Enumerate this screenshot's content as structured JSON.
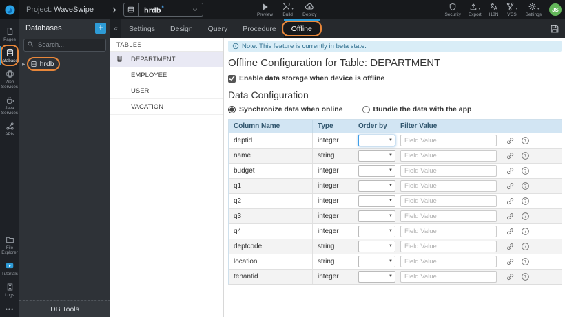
{
  "topbar": {
    "project_prefix": "Project:",
    "project_name": "WaveSwipe",
    "db_selector_value": "hrdb",
    "db_selector_modified_mark": "*",
    "actions": [
      {
        "name": "preview",
        "label": "Preview",
        "icon": "play-icon",
        "caret": false
      },
      {
        "name": "build",
        "label": "Build",
        "icon": "build-icon",
        "caret": true
      },
      {
        "name": "deploy",
        "label": "Deploy",
        "icon": "deploy-icon",
        "caret": false
      }
    ],
    "right_actions": [
      {
        "name": "security",
        "label": "Security",
        "icon": "shield-icon",
        "caret": false
      },
      {
        "name": "export",
        "label": "Export",
        "icon": "export-icon",
        "caret": true
      },
      {
        "name": "i18n",
        "label": "I18N",
        "icon": "translate-icon",
        "caret": false
      },
      {
        "name": "vcs",
        "label": "VCS",
        "icon": "branch-icon",
        "caret": true
      },
      {
        "name": "settings",
        "label": "Settings",
        "icon": "gear-icon",
        "caret": true
      }
    ],
    "avatar_initials": "JS"
  },
  "sidebar": {
    "top_items": [
      {
        "name": "pages",
        "label": "Pages",
        "icon": "page-icon",
        "active": false,
        "annotated": false
      },
      {
        "name": "databases",
        "label": "Databases",
        "icon": "database-icon",
        "active": true,
        "annotated": true
      },
      {
        "name": "web-services",
        "label": "Web Services",
        "icon": "globe-icon",
        "active": false,
        "annotated": false
      },
      {
        "name": "java-services",
        "label": "Java Services",
        "icon": "coffee-icon",
        "active": false,
        "annotated": false
      },
      {
        "name": "apis",
        "label": "APIs",
        "icon": "nodes-icon",
        "active": false,
        "annotated": false
      }
    ],
    "bottom_items": [
      {
        "name": "file-explorer",
        "label": "File Explorer",
        "icon": "folder-icon",
        "active": false,
        "annotated": false
      },
      {
        "name": "tutorials",
        "label": "Tutorials",
        "icon": "video-icon",
        "active": false,
        "annotated": false
      },
      {
        "name": "logs",
        "label": "Logs",
        "icon": "logs-icon",
        "active": false,
        "annotated": false
      }
    ],
    "more_label": "•••"
  },
  "db_panel": {
    "title": "Databases",
    "search_placeholder": "Search...",
    "items": [
      {
        "name": "hrdb",
        "label": "hrdb",
        "annotated": true
      }
    ],
    "footer_label": "DB Tools"
  },
  "tabbar": {
    "tabs": [
      {
        "label": "Settings",
        "active": false,
        "annotated": false
      },
      {
        "label": "Design",
        "active": false,
        "annotated": false
      },
      {
        "label": "Query",
        "active": false,
        "annotated": false
      },
      {
        "label": "Procedure",
        "active": false,
        "annotated": false
      },
      {
        "label": "Offline",
        "active": true,
        "annotated": true
      }
    ]
  },
  "tables_panel": {
    "title": "TABLES",
    "items": [
      {
        "label": "DEPARTMENT",
        "selected": true
      },
      {
        "label": "EMPLOYEE",
        "selected": false
      },
      {
        "label": "USER",
        "selected": false
      },
      {
        "label": "VACATION",
        "selected": false
      }
    ]
  },
  "main": {
    "note_text": "Note: This feature is currently in beta state.",
    "heading": "Offline Configuration for Table: DEPARTMENT",
    "enable_label": "Enable data storage when device is offline",
    "enable_checked": true,
    "section_title": "Data Configuration",
    "radios": [
      {
        "label": "Synchronize data when online",
        "selected": true
      },
      {
        "label": "Bundle the data with the app",
        "selected": false
      }
    ],
    "config_table": {
      "headers": [
        "Column Name",
        "Type",
        "Order by",
        "Filter Value"
      ],
      "filter_placeholder": "Field Value",
      "orderby_value": "",
      "rows": [
        {
          "column": "deptid",
          "type": "integer",
          "focused": true
        },
        {
          "column": "name",
          "type": "string",
          "focused": false
        },
        {
          "column": "budget",
          "type": "integer",
          "focused": false
        },
        {
          "column": "q1",
          "type": "integer",
          "focused": false
        },
        {
          "column": "q2",
          "type": "integer",
          "focused": false
        },
        {
          "column": "q3",
          "type": "integer",
          "focused": false
        },
        {
          "column": "q4",
          "type": "integer",
          "focused": false
        },
        {
          "column": "deptcode",
          "type": "string",
          "focused": false
        },
        {
          "column": "location",
          "type": "string",
          "focused": false
        },
        {
          "column": "tenantid",
          "type": "integer",
          "focused": false
        }
      ]
    }
  },
  "colors": {
    "accent_blue": "#2e9bd6",
    "annotation_orange": "#e8873a",
    "note_bg": "#d9edf7",
    "note_text": "#31708f",
    "table_header_bg": "#d2e5f3",
    "table_header_text": "#31566e",
    "selected_table_row_bg": "#e9e9f4",
    "avatar_green": "#63b75a",
    "topbar_bg": "#17191c",
    "panel_bg": "#2e3237"
  }
}
